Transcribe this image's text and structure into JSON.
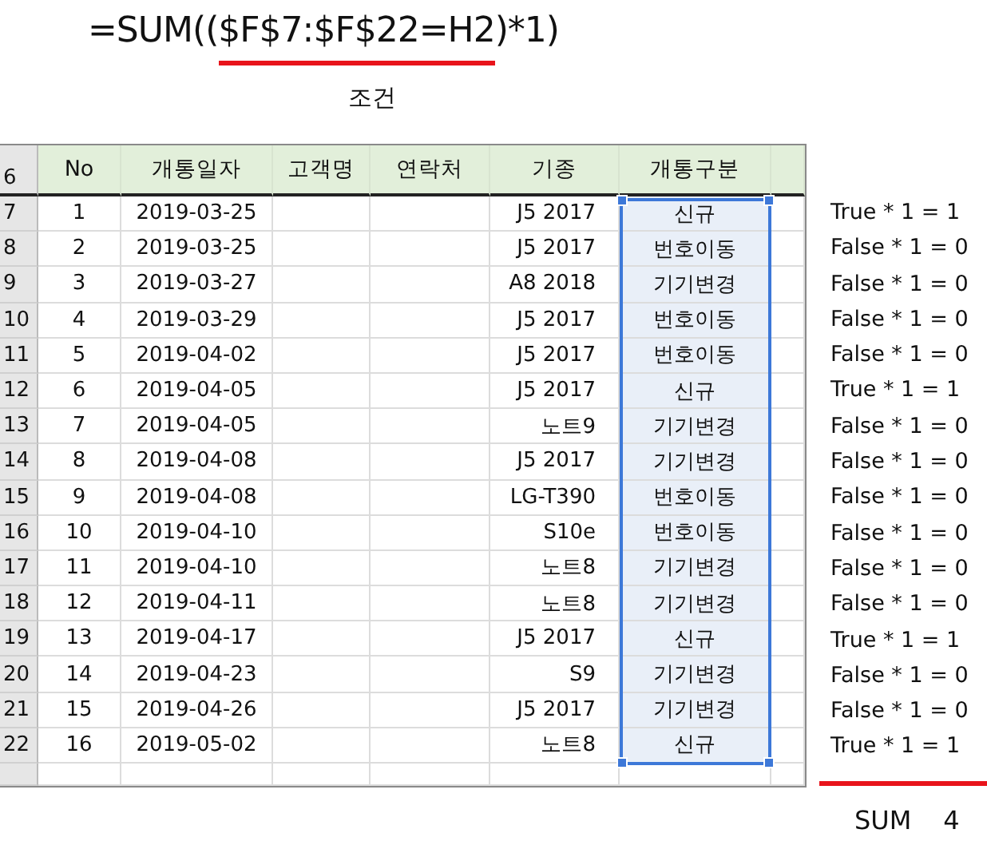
{
  "formula": {
    "parts": [
      {
        "text": "=SUM((",
        "underlined": false
      },
      {
        "text": "$F$7:$F$22=H2",
        "underlined": true
      },
      {
        "text": ")*1)",
        "underlined": false
      }
    ],
    "caption": "조건"
  },
  "sheet": {
    "header_row": "6",
    "columns": [
      {
        "label": "No",
        "selected": false
      },
      {
        "label": "개통일자",
        "selected": false
      },
      {
        "label": "고객명",
        "selected": false
      },
      {
        "label": "연락처",
        "selected": false
      },
      {
        "label": "기종",
        "selected": false
      },
      {
        "label": "개통구분",
        "selected": true
      }
    ],
    "rows": [
      {
        "row": "7",
        "cells": [
          "1",
          "2019-03-25",
          "",
          "",
          "J5 2017",
          "신규"
        ]
      },
      {
        "row": "8",
        "cells": [
          "2",
          "2019-03-25",
          "",
          "",
          "J5 2017",
          "번호이동"
        ]
      },
      {
        "row": "9",
        "cells": [
          "3",
          "2019-03-27",
          "",
          "",
          "A8 2018",
          "기기변경"
        ]
      },
      {
        "row": "10",
        "cells": [
          "4",
          "2019-03-29",
          "",
          "",
          "J5 2017",
          "번호이동"
        ]
      },
      {
        "row": "11",
        "cells": [
          "5",
          "2019-04-02",
          "",
          "",
          "J5 2017",
          "번호이동"
        ]
      },
      {
        "row": "12",
        "cells": [
          "6",
          "2019-04-05",
          "",
          "",
          "J5 2017",
          "신규"
        ]
      },
      {
        "row": "13",
        "cells": [
          "7",
          "2019-04-05",
          "",
          "",
          "노트9",
          "기기변경"
        ]
      },
      {
        "row": "14",
        "cells": [
          "8",
          "2019-04-08",
          "",
          "",
          "J5 2017",
          "기기변경"
        ]
      },
      {
        "row": "15",
        "cells": [
          "9",
          "2019-04-08",
          "",
          "",
          "LG-T390",
          "번호이동"
        ]
      },
      {
        "row": "16",
        "cells": [
          "10",
          "2019-04-10",
          "",
          "",
          "S10e",
          "번호이동"
        ]
      },
      {
        "row": "17",
        "cells": [
          "11",
          "2019-04-10",
          "",
          "",
          "노트8",
          "기기변경"
        ]
      },
      {
        "row": "18",
        "cells": [
          "12",
          "2019-04-11",
          "",
          "",
          "노트8",
          "기기변경"
        ]
      },
      {
        "row": "19",
        "cells": [
          "13",
          "2019-04-17",
          "",
          "",
          "J5 2017",
          "신규"
        ]
      },
      {
        "row": "20",
        "cells": [
          "14",
          "2019-04-23",
          "",
          "",
          "S9",
          "기기변경"
        ]
      },
      {
        "row": "21",
        "cells": [
          "15",
          "2019-04-26",
          "",
          "",
          "J5 2017",
          "기기변경"
        ]
      },
      {
        "row": "22",
        "cells": [
          "16",
          "2019-05-02",
          "",
          "",
          "노트8",
          "신규"
        ]
      }
    ]
  },
  "results": [
    "True * 1 = 1",
    "False * 1 = 0",
    "False * 1 = 0",
    "False * 1 = 0",
    "False * 1 = 0",
    "True * 1 = 1",
    "False * 1 = 0",
    "False * 1 = 0",
    "False * 1 = 0",
    "False * 1 = 0",
    "False * 1 = 0",
    "False * 1 = 0",
    "True * 1 = 1",
    "False * 1 = 0",
    "False * 1 = 0",
    "True * 1 = 1"
  ],
  "sum": {
    "label": "SUM",
    "value": "4"
  }
}
